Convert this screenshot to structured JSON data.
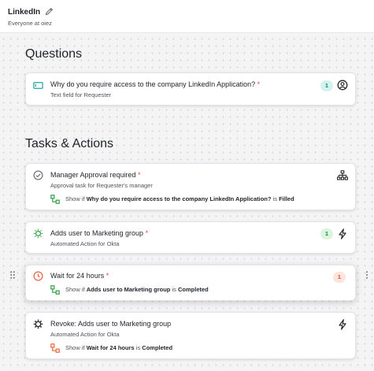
{
  "header": {
    "title": "LinkedIn",
    "subtitle": "Everyone at oiez",
    "edit_icon": "pencil-icon"
  },
  "questions": {
    "heading": "Questions",
    "items": [
      {
        "title": "Why do you require access to the company LinkedIn Application?",
        "required": "*",
        "subtitle": "Text field for Requester",
        "badge": "1",
        "icon": "text-field-icon",
        "right_icon": "user-circle-icon"
      }
    ]
  },
  "tasks": {
    "heading": "Tasks & Actions",
    "show_if": "Show if",
    "is": "is",
    "items": [
      {
        "title": "Manager Approval required",
        "required": "*",
        "subtitle": "Approval task for Requester's manager",
        "icon": "check-circle-icon",
        "right_icon": "org-chart-icon",
        "condition": {
          "field": "Why do you require access to the company LinkedIn Application?",
          "value": "Filled"
        }
      },
      {
        "title": "Adds user to Marketing group",
        "required": "*",
        "subtitle": "Automated Action for Okta",
        "badge": "1",
        "icon": "okta-sun-icon",
        "right_icon": "lightning-icon"
      },
      {
        "title": "Wait for 24 hours",
        "required": "*",
        "badge": "1",
        "icon": "clock-icon",
        "condition": {
          "field": "Adds user to Marketing group",
          "value": "Completed"
        }
      },
      {
        "title": "Revoke: Adds user to Marketing group",
        "subtitle": "Automated Action for Okta",
        "icon": "okta-gear-icon",
        "right_icon": "lightning-icon",
        "condition": {
          "field": "Wait for 24 hours",
          "value": "Completed"
        }
      }
    ]
  },
  "colors": {
    "teal": "#1aa89a",
    "green": "#2ea043",
    "orange": "#e8643c",
    "required": "#e5484d"
  }
}
